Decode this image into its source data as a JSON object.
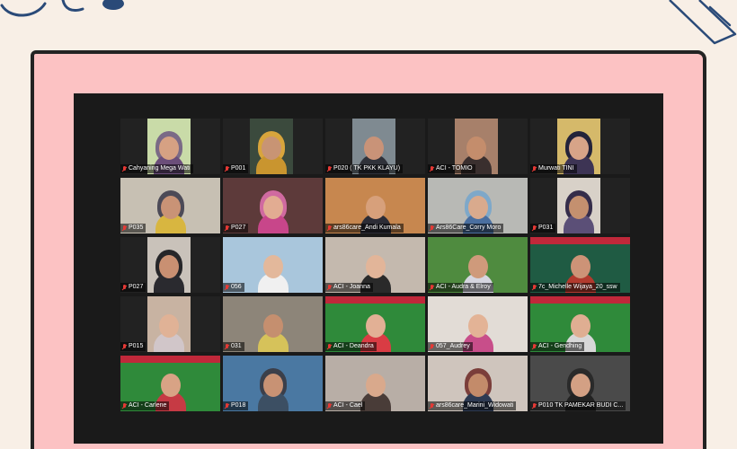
{
  "participants": [
    {
      "name": "Cahyaning Mega Wati",
      "layout": "narrow",
      "bg": "#c9dba8",
      "skin": "#d6a183",
      "cloth": "#6b4e7a",
      "hijab": "#7a6a86",
      "muted": true
    },
    {
      "name": "P001",
      "layout": "narrow",
      "bg": "#3b4a3d",
      "skin": "#c89474",
      "cloth": "#c9952f",
      "hijab": "#d8a53c",
      "muted": true
    },
    {
      "name": "P020 ( TK PKK KLAYU)",
      "layout": "narrow",
      "bg": "#7f8a91",
      "skin": "#c99378",
      "cloth": "#30323a",
      "hijab": "",
      "muted": true
    },
    {
      "name": "ACI - TOMIO",
      "layout": "narrow",
      "bg": "#a7806a",
      "skin": "#c48d6c",
      "cloth": "#3a2f2e",
      "hijab": "",
      "muted": true
    },
    {
      "name": "Murwati TINI",
      "layout": "narrow",
      "bg": "#d5b96a",
      "skin": "#d7a488",
      "cloth": "#3d3454",
      "hijab": "#23233a",
      "muted": true
    },
    {
      "name": "P035",
      "layout": "wide",
      "bg": "#c7c0b3",
      "skin": "#c99376",
      "cloth": "#d8b640",
      "hijab": "#4c4a57",
      "muted": true
    },
    {
      "name": "P027",
      "layout": "wide",
      "bg": "#5d3a3a",
      "skin": "#e2ac92",
      "cloth": "#c8468a",
      "hijab": "#d06aa0",
      "muted": true
    },
    {
      "name": "ars86care_Andi Kumala",
      "layout": "wide",
      "bg": "#c7874f",
      "skin": "#d7a07b",
      "cloth": "#2c2c36",
      "hijab": "",
      "muted": true
    },
    {
      "name": "Ars86Care_Corry Moro",
      "layout": "wide",
      "bg": "#b8b9b5",
      "skin": "#d9aa8d",
      "cloth": "#4a6fa0",
      "hijab": "#7ea8c9",
      "muted": true
    },
    {
      "name": "P031",
      "layout": "narrow",
      "bg": "#d8d1c8",
      "skin": "#c4906f",
      "cloth": "#5b4f77",
      "hijab": "#352d4a",
      "muted": true
    },
    {
      "name": "P027",
      "layout": "narrow",
      "bg": "#c9c2ba",
      "skin": "#c99072",
      "cloth": "#2a2a2f",
      "hijab": "#262629",
      "muted": true
    },
    {
      "name": "056",
      "layout": "wide",
      "bg": "#a9c6dc",
      "skin": "#e3b89b",
      "cloth": "#f0f0f0",
      "hijab": "",
      "muted": true
    },
    {
      "name": "ACI - Joanna",
      "layout": "wide",
      "bg": "#c4b9ae",
      "skin": "#e2b599",
      "cloth": "#2a2a2a",
      "hijab": "",
      "muted": true
    },
    {
      "name": "ACI - Audra & Elroy",
      "layout": "wide",
      "bg": "#4f8b3f",
      "skin": "#cf9a7b",
      "cloth": "#d6d6e0",
      "hijab": "",
      "muted": true
    },
    {
      "name": "7c_Michelle Wijaya_20_ssw",
      "layout": "wide",
      "bg": "#1f5b43",
      "skin": "#cd9377",
      "cloth": "#b23a2e",
      "hijab": "",
      "muted": true
    },
    {
      "name": "P015",
      "layout": "narrow",
      "bg": "#c8b3a2",
      "skin": "#e0b296",
      "cloth": "#d1c6c9",
      "hijab": "",
      "muted": true
    },
    {
      "name": "031",
      "layout": "wide",
      "bg": "#8d8579",
      "skin": "#c58f6f",
      "cloth": "#d6c25a",
      "hijab": "",
      "muted": true
    },
    {
      "name": "ACI - Deandra",
      "layout": "wide",
      "bg": "#2f8a3a",
      "skin": "#e2b095",
      "cloth": "#d93c44",
      "hijab": "",
      "muted": true
    },
    {
      "name": "057_Audrey",
      "layout": "wide",
      "bg": "#e2dcd6",
      "skin": "#e3b396",
      "cloth": "#c84e8a",
      "hijab": "",
      "muted": true
    },
    {
      "name": "ACI - Gendhing",
      "layout": "wide",
      "bg": "#2f8a3a",
      "skin": "#dfae92",
      "cloth": "#d7d7d7",
      "hijab": "",
      "muted": true
    },
    {
      "name": "ACI - Carlene",
      "layout": "wide",
      "bg": "#2f8a3a",
      "skin": "#d8a385",
      "cloth": "#c63a44",
      "hijab": "",
      "muted": true
    },
    {
      "name": "P018",
      "layout": "wide",
      "bg": "#4a78a2",
      "skin": "#c89274",
      "cloth": "#3c4f63",
      "hijab": "#3b3f4a",
      "muted": true
    },
    {
      "name": "ACI - Cael",
      "layout": "wide",
      "bg": "#b8aea6",
      "skin": "#d9a98c",
      "cloth": "#493c38",
      "hijab": "",
      "muted": true
    },
    {
      "name": "ars86care_Marini_Widowati",
      "layout": "wide",
      "bg": "#cfc5bd",
      "skin": "#c38b6a",
      "cloth": "#2d3a52",
      "hijab": "#7b3e3a",
      "muted": true
    },
    {
      "name": "P010 TK PAMEKAR BUDI C...",
      "layout": "wide",
      "bg": "#4a4a4a",
      "skin": "#d3a084",
      "cloth": "#222222",
      "hijab": "#2a2a2a",
      "muted": true
    }
  ],
  "banner_tiles": [
    "ACI - Deandra",
    "ACI - Gendhing",
    "ACI - Carlene",
    "7c_Michelle Wijaya_20_ssw"
  ]
}
